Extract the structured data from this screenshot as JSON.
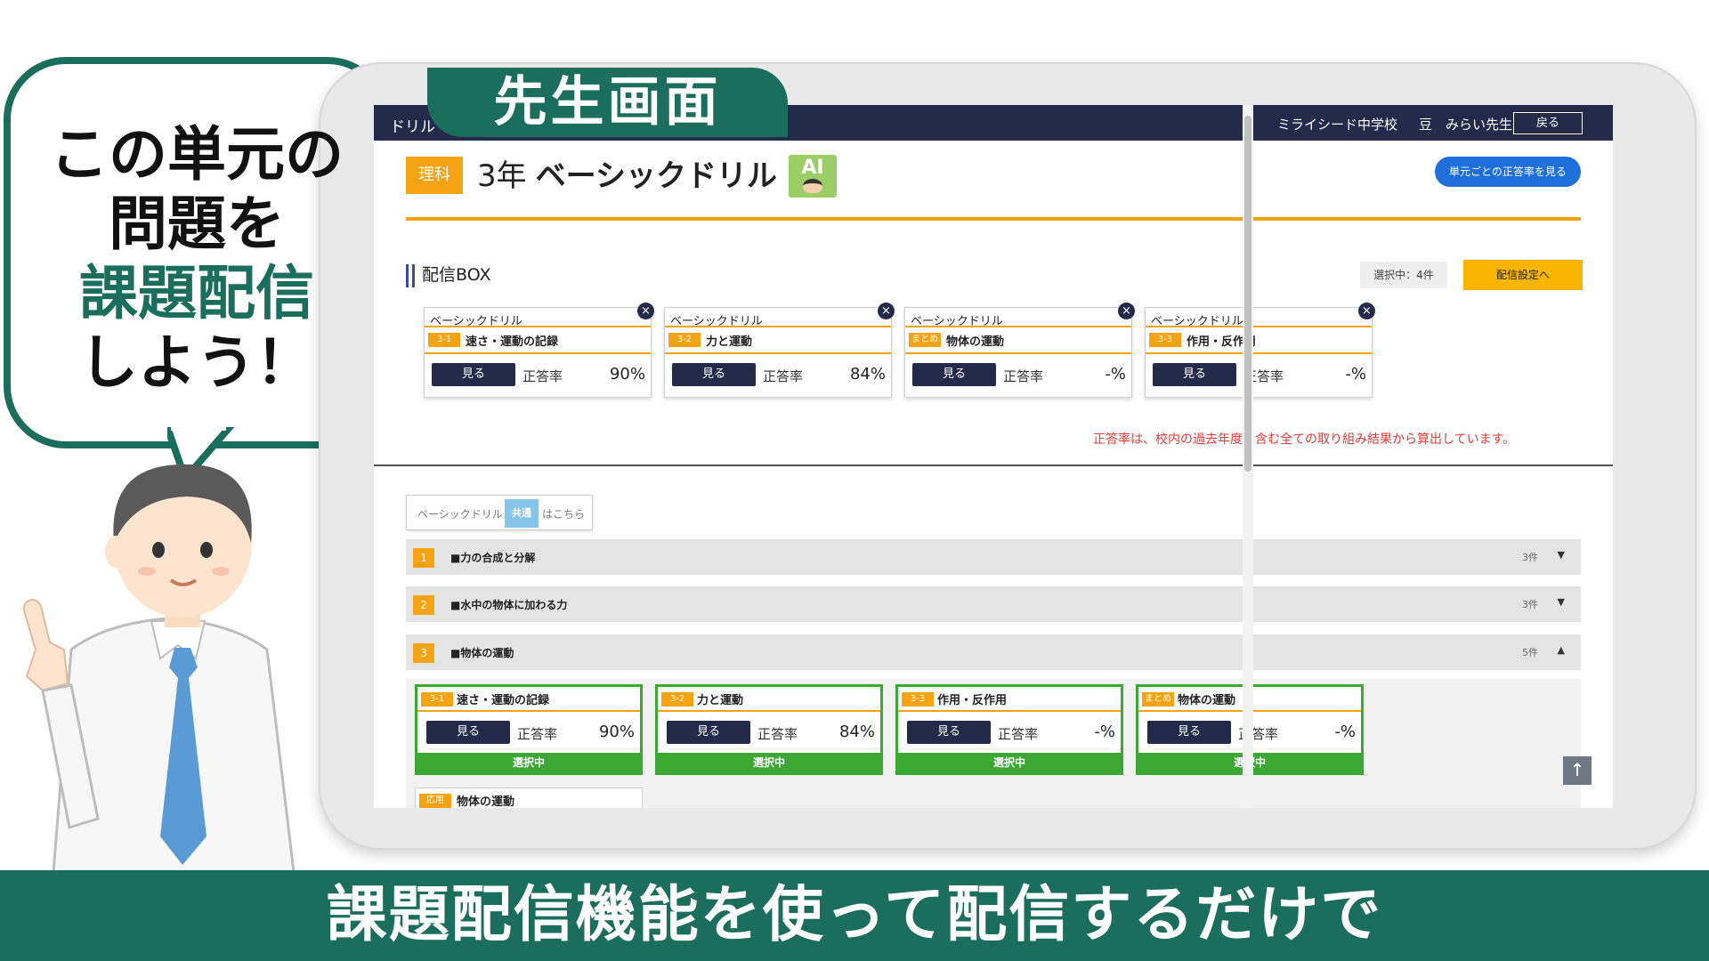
{
  "topbar": {
    "app": "ドリル",
    "school": "ミライシード中学校",
    "bean": "豆",
    "teacher": "みらい先生",
    "back_label": "戻る"
  },
  "teacher_tab": "先生画面",
  "header": {
    "subject": "理科",
    "grade": "3年",
    "drill_name": "ベーシックドリル",
    "ai_badge": "AI",
    "unit_rate_button": "単元ごとの正答率を見る"
  },
  "box": {
    "title": "配信BOX",
    "selected_count": "選択中：4件",
    "delivery_button": "配信設定へ",
    "cards": [
      {
        "category": "ベーシックドリル",
        "num": "3-1",
        "name": "速さ・運動の記録",
        "view": "見る",
        "rate_label": "正答率",
        "rate": "90%"
      },
      {
        "category": "ベーシックドリル",
        "num": "3-2",
        "name": "力と運動",
        "view": "見る",
        "rate_label": "正答率",
        "rate": "84%"
      },
      {
        "category": "ベーシックドリル",
        "num": "まとめ",
        "name": "物体の運動",
        "view": "見る",
        "rate_label": "正答率",
        "rate": "-%"
      },
      {
        "category": "ベーシックドリル",
        "num": "3-3",
        "name": "作用・反作用",
        "view": "見る",
        "rate_label": "正答率",
        "rate": "-%"
      }
    ],
    "close_icon": "×"
  },
  "note": "正答率は、校内の過去年度を含む全ての取り組み結果から算出しています。",
  "common_button": {
    "text1": "ベーシックドリル",
    "badge": "共通",
    "text2": "はこちら"
  },
  "sections": [
    {
      "index": "1",
      "title": "■力の合成と分解",
      "count": "3件",
      "arrow": "▼"
    },
    {
      "index": "2",
      "title": "■水中の物体に加わる力",
      "count": "3件",
      "arrow": "▼"
    },
    {
      "index": "3",
      "title": "■物体の運動",
      "count": "5件",
      "arrow": "▲"
    }
  ],
  "section3_cards": [
    {
      "num": "3-1",
      "name": "速さ・運動の記録",
      "view": "見る",
      "rate_label": "正答率",
      "rate": "90%",
      "selected": "選択中"
    },
    {
      "num": "3-2",
      "name": "力と運動",
      "view": "見る",
      "rate_label": "正答率",
      "rate": "84%",
      "selected": "選択中"
    },
    {
      "num": "3-3",
      "name": "作用・反作用",
      "view": "見る",
      "rate_label": "正答率",
      "rate": "-%",
      "selected": "選択中"
    },
    {
      "num": "まとめ",
      "name": "物体の運動",
      "view": "見る",
      "rate_label": "正答率",
      "rate": "-%",
      "selected": "選択中"
    }
  ],
  "extra_card": {
    "num": "応用",
    "name": "物体の運動"
  },
  "scroll_top_icon": "↑",
  "bubble": {
    "line1": "この単元の",
    "line2": "問題を",
    "line3": "課題配信",
    "line4": "しよう！"
  },
  "banner": "課題配信機能を使って配信するだけで",
  "colors": {
    "brand_green": "#1b6e5c",
    "navy": "#242a4a",
    "orange": "#f5a313",
    "selected_green": "#3aa832",
    "note_red": "#e53935"
  }
}
